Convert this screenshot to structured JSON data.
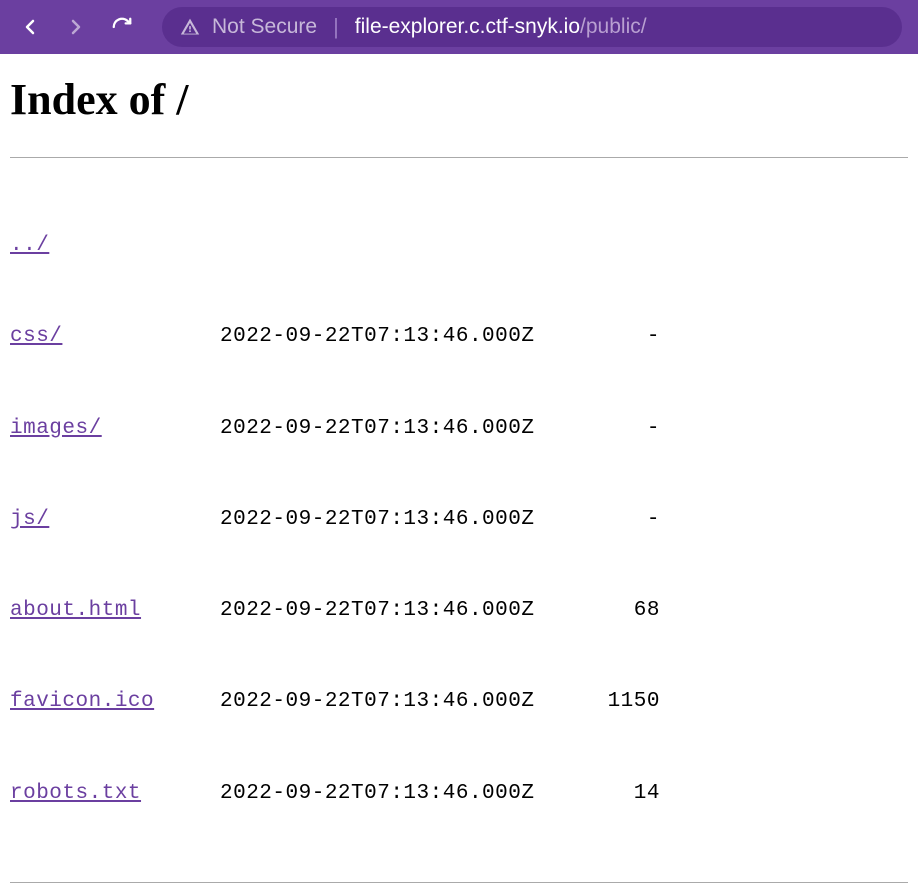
{
  "browser": {
    "not_secure_label": "Not Secure",
    "url_domain": "file-explorer.c.ctf-snyk.io",
    "url_path": "/public/"
  },
  "page": {
    "title": "Index of /"
  },
  "listing": {
    "parent": "../",
    "entries": [
      {
        "name": "css/",
        "date": "2022-09-22T07:13:46.000Z",
        "size": "-"
      },
      {
        "name": "images/",
        "date": "2022-09-22T07:13:46.000Z",
        "size": "-"
      },
      {
        "name": "js/",
        "date": "2022-09-22T07:13:46.000Z",
        "size": "-"
      },
      {
        "name": "about.html",
        "date": "2022-09-22T07:13:46.000Z",
        "size": "68"
      },
      {
        "name": "favicon.ico",
        "date": "2022-09-22T07:13:46.000Z",
        "size": "1150"
      },
      {
        "name": "robots.txt",
        "date": "2022-09-22T07:13:46.000Z",
        "size": "14"
      }
    ]
  }
}
